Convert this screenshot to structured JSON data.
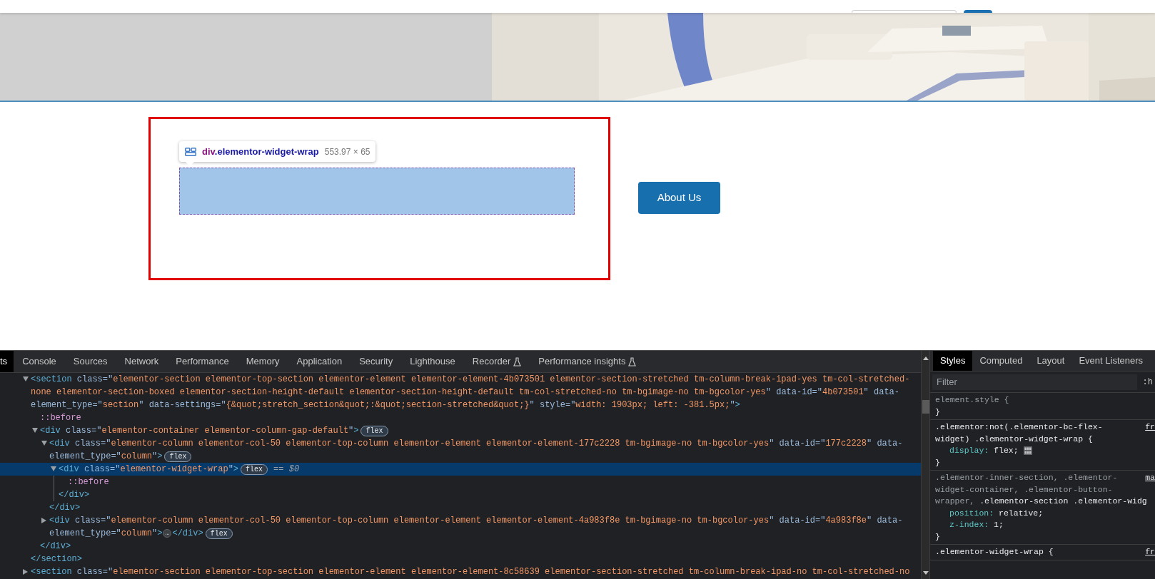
{
  "page": {
    "inspector_tooltip": {
      "tag": "div",
      "class_name": ".elementor-widget-wrap",
      "size": "553.97 × 65"
    },
    "about_button": "About Us"
  },
  "devtools": {
    "tabs": [
      {
        "label": "ts",
        "selected": true,
        "experimental": false
      },
      {
        "label": "Console",
        "selected": false,
        "experimental": false
      },
      {
        "label": "Sources",
        "selected": false,
        "experimental": false
      },
      {
        "label": "Network",
        "selected": false,
        "experimental": false
      },
      {
        "label": "Performance",
        "selected": false,
        "experimental": false
      },
      {
        "label": "Memory",
        "selected": false,
        "experimental": false
      },
      {
        "label": "Application",
        "selected": false,
        "experimental": false
      },
      {
        "label": "Security",
        "selected": false,
        "experimental": false
      },
      {
        "label": "Lighthouse",
        "selected": false,
        "experimental": false
      },
      {
        "label": "Recorder",
        "selected": false,
        "experimental": true
      },
      {
        "label": "Performance insights",
        "selected": false,
        "experimental": true
      }
    ],
    "dom_tree": [
      {
        "kind": "element",
        "expanded": true,
        "selected": false,
        "lines": [
          [
            {
              "kind": "tag",
              "text": "<section"
            },
            {
              "kind": "attr",
              "text": " class=\""
            },
            {
              "kind": "value",
              "text": "elementor-section elementor-top-section elementor-element elementor-element-4b073501 elementor-section-stretched tm-column-break-ipad-yes tm-col-stretched-"
            }
          ],
          [
            {
              "kind": "value",
              "text": "none elementor-section-boxed elementor-section-height-default elementor-section-height-default tm-col-stretched-no tm-bgimage-no tm-bgcolor-yes"
            },
            {
              "kind": "attr",
              "text": "\" data-id=\""
            },
            {
              "kind": "value",
              "text": "4b073501"
            },
            {
              "kind": "attr",
              "text": "\" data-"
            }
          ],
          [
            {
              "kind": "attr",
              "text": "element_type=\""
            },
            {
              "kind": "value",
              "text": "section"
            },
            {
              "kind": "attr",
              "text": "\" data-settings=\""
            },
            {
              "kind": "value",
              "text": "{&quot;stretch_section&quot;:&quot;section-stretched&quot;}"
            },
            {
              "kind": "attr",
              "text": "\" style=\""
            },
            {
              "kind": "value",
              "text": "width: 1903px; left: -381.5px;"
            },
            {
              "kind": "attr",
              "text": "\""
            },
            {
              "kind": "tag",
              "text": ">"
            }
          ]
        ],
        "children": [
          {
            "kind": "pseudo",
            "text": "::before"
          },
          {
            "kind": "element",
            "expanded": true,
            "selected": false,
            "lines": [
              [
                {
                  "kind": "tag",
                  "text": "<div"
                },
                {
                  "kind": "attr",
                  "text": " class=\""
                },
                {
                  "kind": "value",
                  "text": "elementor-container elementor-column-gap-default"
                },
                {
                  "kind": "attr",
                  "text": "\""
                },
                {
                  "kind": "tag",
                  "text": ">"
                },
                {
                  "kind": "badge",
                  "text": "flex"
                }
              ]
            ],
            "children": [
              {
                "kind": "element",
                "expanded": true,
                "selected": false,
                "lines": [
                  [
                    {
                      "kind": "tag",
                      "text": "<div"
                    },
                    {
                      "kind": "attr",
                      "text": " class=\""
                    },
                    {
                      "kind": "value",
                      "text": "elementor-column elementor-col-50 elementor-top-column elementor-element elementor-element-177c2228 tm-bgimage-no tm-bgcolor-yes"
                    },
                    {
                      "kind": "attr",
                      "text": "\" data-id=\""
                    },
                    {
                      "kind": "value",
                      "text": "177c2228"
                    },
                    {
                      "kind": "attr",
                      "text": "\" data-"
                    }
                  ],
                  [
                    {
                      "kind": "attr",
                      "text": "element_type=\""
                    },
                    {
                      "kind": "value",
                      "text": "column"
                    },
                    {
                      "kind": "attr",
                      "text": "\""
                    },
                    {
                      "kind": "tag",
                      "text": ">"
                    },
                    {
                      "kind": "badge",
                      "text": "flex"
                    }
                  ]
                ],
                "children": [
                  {
                    "kind": "element",
                    "expanded": true,
                    "selected": true,
                    "lines": [
                      [
                        {
                          "kind": "tag",
                          "text": "<div"
                        },
                        {
                          "kind": "attr",
                          "text": " class=\""
                        },
                        {
                          "kind": "value",
                          "text": "elementor-widget-wrap"
                        },
                        {
                          "kind": "attr",
                          "text": "\""
                        },
                        {
                          "kind": "tag",
                          "text": ">"
                        },
                        {
                          "kind": "badge",
                          "text": "flex"
                        },
                        {
                          "kind": "note",
                          "text": "== $0"
                        }
                      ]
                    ],
                    "children": [
                      {
                        "kind": "pseudo",
                        "text": "::before"
                      }
                    ],
                    "closing": "</div>"
                  }
                ],
                "closing": "</div>"
              },
              {
                "kind": "element",
                "expanded": false,
                "selected": false,
                "lines": [
                  [
                    {
                      "kind": "tag",
                      "text": "<div"
                    },
                    {
                      "kind": "attr",
                      "text": " class=\""
                    },
                    {
                      "kind": "value",
                      "text": "elementor-column elementor-col-50 elementor-top-column elementor-element elementor-element-4a983f8e tm-bgimage-no tm-bgcolor-yes"
                    },
                    {
                      "kind": "attr",
                      "text": "\" data-id=\""
                    },
                    {
                      "kind": "value",
                      "text": "4a983f8e"
                    },
                    {
                      "kind": "attr",
                      "text": "\" data-"
                    }
                  ],
                  [
                    {
                      "kind": "attr",
                      "text": "element_type=\""
                    },
                    {
                      "kind": "value",
                      "text": "column"
                    },
                    {
                      "kind": "attr",
                      "text": "\""
                    },
                    {
                      "kind": "tag",
                      "text": ">"
                    },
                    {
                      "kind": "ellipsis",
                      "text": "…"
                    },
                    {
                      "kind": "tag",
                      "text": "</div>"
                    },
                    {
                      "kind": "badge",
                      "text": "flex"
                    }
                  ]
                ]
              }
            ],
            "closing": "</div>"
          }
        ],
        "closing": "</section>"
      },
      {
        "kind": "element",
        "expanded": false,
        "selected": false,
        "lines": [
          [
            {
              "kind": "tag",
              "text": "<section"
            },
            {
              "kind": "attr",
              "text": " class=\""
            },
            {
              "kind": "value",
              "text": "elementor-section elementor-top-section elementor-element elementor-element-8c58639 elementor-section-stretched tm-column-break-ipad-no tm-col-stretched-no"
            }
          ]
        ]
      }
    ],
    "styles_panel": {
      "tabs": [
        {
          "label": "Styles",
          "selected": true
        },
        {
          "label": "Computed",
          "selected": false
        },
        {
          "label": "Layout",
          "selected": false
        },
        {
          "label": "Event Listeners",
          "selected": false
        }
      ],
      "filter_placeholder": "Filter",
      "state_toggle": ":h",
      "rules": [
        {
          "selector_lines": [
            [
              {
                "text": "element.style {",
                "matched": false
              }
            ]
          ],
          "close": "}"
        },
        {
          "selector_lines": [
            [
              {
                "text": ".elementor:not(.elementor-bc-flex-",
                "matched": true
              }
            ],
            [
              {
                "text": "widget) .elementor-widget-wrap {",
                "matched": true
              }
            ]
          ],
          "source": "fr",
          "declarations": [
            {
              "kind": "flex-editor",
              "property": "display:",
              "value": "flex;"
            }
          ],
          "close": "}"
        },
        {
          "selector_lines": [
            [
              {
                "text": ".elementor-inner-section, .elementor-",
                "matched": false
              }
            ],
            [
              {
                "text": "widget-container, .elementor-button-",
                "matched": false
              }
            ],
            [
              {
                "text": "wrapper, ",
                "matched": false
              },
              {
                "text": ".elementor-section .elementor-widg",
                "matched": true
              }
            ]
          ],
          "source": "ma",
          "declarations": [
            {
              "kind": "plain",
              "property": "position:",
              "value": "relative;"
            },
            {
              "kind": "plain",
              "property": "z-index:",
              "value": "1;"
            }
          ],
          "close": "}"
        },
        {
          "selector_lines": [
            [
              {
                "text": ".elementor-widget-wrap {",
                "matched": true
              }
            ]
          ],
          "source": "fr"
        }
      ]
    }
  }
}
